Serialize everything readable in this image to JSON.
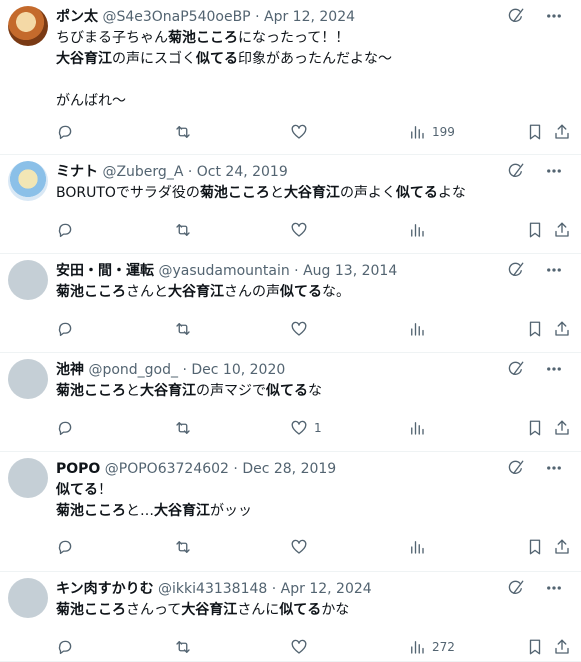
{
  "tweets": [
    {
      "name": "ポン太",
      "handle": "@S4e3OnaP540oeBP",
      "date": "Apr 12, 2024",
      "lines": [
        [
          {
            "t": "ちびまる子ちゃん"
          },
          {
            "t": "菊池こころ",
            "b": true
          },
          {
            "t": "になったって！！"
          }
        ],
        [
          {
            "t": "大谷育江",
            "b": true
          },
          {
            "t": "の声にスゴく"
          },
          {
            "t": "似てる",
            "b": true
          },
          {
            "t": "印象があったんだよな〜"
          }
        ],
        [
          {
            "t": " "
          }
        ],
        [
          {
            "t": "がんばれ〜"
          }
        ]
      ],
      "likes": "",
      "views": "199"
    },
    {
      "name": "ミナト",
      "handle": "@Zuberg_A",
      "date": "Oct 24, 2019",
      "lines": [
        [
          {
            "t": "BORUTOでサラダ役の"
          },
          {
            "t": "菊池こころ",
            "b": true
          },
          {
            "t": "と"
          },
          {
            "t": "大谷育江",
            "b": true
          },
          {
            "t": "の声よく"
          },
          {
            "t": "似てる",
            "b": true
          },
          {
            "t": "よな"
          }
        ]
      ],
      "likes": "",
      "views": ""
    },
    {
      "name": "安田・間・運転",
      "handle": "@yasudamountain",
      "date": "Aug 13, 2014",
      "lines": [
        [
          {
            "t": "菊池こころ",
            "b": true
          },
          {
            "t": "さんと"
          },
          {
            "t": "大谷育江",
            "b": true
          },
          {
            "t": "さんの声"
          },
          {
            "t": "似てる",
            "b": true
          },
          {
            "t": "な。"
          }
        ]
      ],
      "likes": "",
      "views": ""
    },
    {
      "name": "池神",
      "handle": "@pond_god_",
      "date": "Dec 10, 2020",
      "lines": [
        [
          {
            "t": "菊池こころ",
            "b": true
          },
          {
            "t": "と"
          },
          {
            "t": "大谷育江",
            "b": true
          },
          {
            "t": "の声マジで"
          },
          {
            "t": "似てる",
            "b": true
          },
          {
            "t": "な"
          }
        ]
      ],
      "likes": "1",
      "views": ""
    },
    {
      "name": "POPO",
      "handle": "@POPO63724602",
      "date": "Dec 28, 2019",
      "lines": [
        [
          {
            "t": "似てる",
            "b": true
          },
          {
            "t": "！"
          }
        ],
        [
          {
            "t": "菊池こころ",
            "b": true
          },
          {
            "t": "と…"
          },
          {
            "t": "大谷育江",
            "b": true
          },
          {
            "t": "がッッ"
          }
        ]
      ],
      "likes": "",
      "views": ""
    },
    {
      "name": "キン肉すかりむ",
      "handle": "@ikki43138148",
      "date": "Apr 12, 2024",
      "lines": [
        [
          {
            "t": "菊池こころ",
            "b": true
          },
          {
            "t": "さんって"
          },
          {
            "t": "大谷育江",
            "b": true
          },
          {
            "t": "さんに"
          },
          {
            "t": "似てる",
            "b": true
          },
          {
            "t": "かな"
          }
        ]
      ],
      "likes": "",
      "views": "272"
    }
  ],
  "icons": {
    "grok": "grok-icon",
    "more": "more-icon",
    "reply": "reply-icon",
    "retweet": "retweet-icon",
    "like": "like-icon",
    "views": "views-icon",
    "bookmark": "bookmark-icon",
    "share": "share-icon"
  },
  "colors": {
    "text": "#0f1419",
    "secondary": "#536471",
    "divider": "#eff3f4"
  }
}
